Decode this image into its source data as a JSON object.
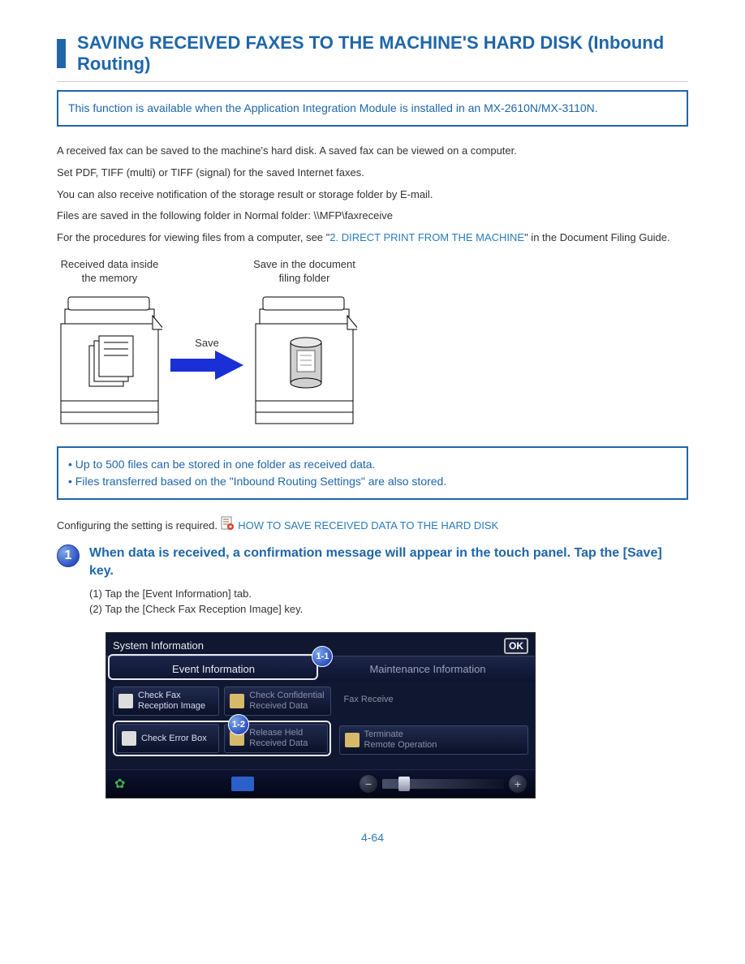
{
  "section": {
    "title": "SAVING RECEIVED FAXES TO THE MACHINE'S HARD DISK (Inbound Routing)"
  },
  "callout1": "This function is available when the Application Integration Module is installed in an MX-2610N/MX-3110N.",
  "para1": "A received fax can be saved to the machine's hard disk. A saved fax can be viewed on a computer.",
  "para2": "Set PDF, TIFF (multi) or TIFF (signal) for the saved Internet faxes.",
  "para3": "You can also receive notification of the storage result or storage folder by E-mail.",
  "para4_a": "Files are saved in the following folder in Normal folder: \\\\MFP\\faxreceive",
  "para4_b": {
    "prefix": "For the procedures for viewing files from a computer, see \"",
    "link": "2. DIRECT PRINT FROM THE MACHINE",
    "suffix": "\" in the Document Filing Guide."
  },
  "diagram": {
    "left_caption": "Received data inside\nthe memory",
    "arrow_label": "Save",
    "right_caption": "Save in the document\nfiling folder"
  },
  "callout2_line1": "• Up to 500 files can be stored in one folder as received data.",
  "callout2_line2": "• Files transferred based on the \"Inbound Routing Settings\" are also stored.",
  "note_prefix": "Configuring the setting is required. ",
  "note_icon_label": "doc-settings-icon",
  "note_link": "HOW TO SAVE RECEIVED DATA TO THE HARD DISK",
  "step": {
    "num": "1",
    "title": "When data is received, a confirmation message will appear in the touch panel. Tap the [Save] key.",
    "sub": "(1) Tap the [Event Information] tab.\n(2) Tap the [Check Fax Reception Image] key.",
    "badge_1_1": "1-1",
    "badge_1_2": "1-2"
  },
  "panel": {
    "title": "System Information",
    "ok": "OK",
    "tab_event": "Event Information",
    "tab_maint": "Maintenance Information",
    "btn_checkfax": "Check Fax\nReception Image",
    "btn_checkconf": "Check Confidential\nReceived Data",
    "btn_errorbox": "Check Error Box",
    "btn_release": "Release Held\nReceived Data",
    "btn_faxreceive": "Fax Receive",
    "btn_terminate": "Terminate\nRemote Operation"
  },
  "page_number": "4-64"
}
